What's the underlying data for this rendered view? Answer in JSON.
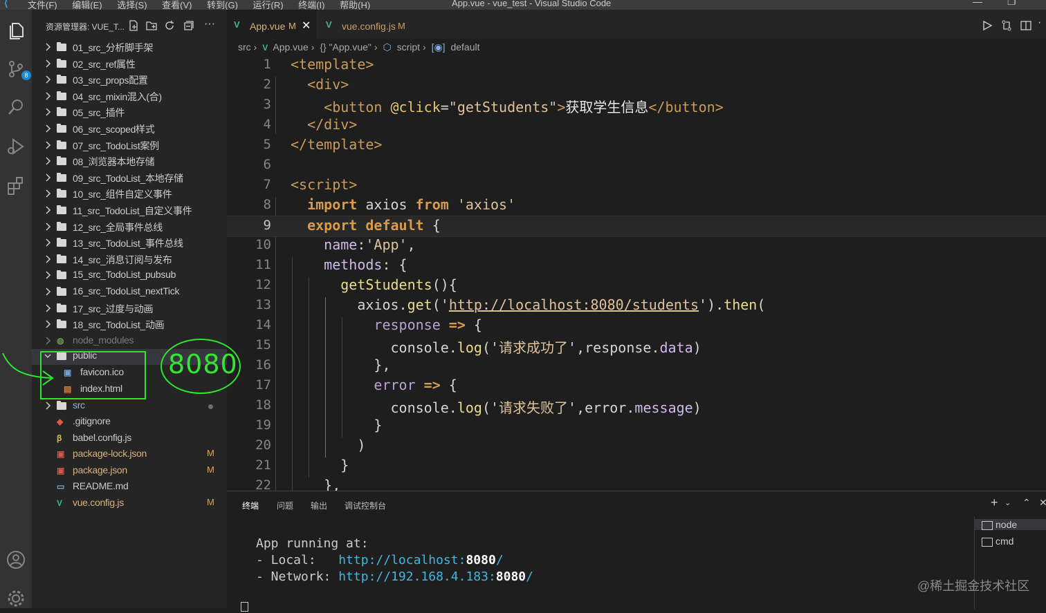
{
  "titlebar": {
    "menu": [
      "文件(F)",
      "编辑(E)",
      "选择(S)",
      "查看(V)",
      "转到(G)",
      "运行(R)",
      "终端(I)",
      "帮助(H)"
    ],
    "title": "App.vue - vue_test - Visual Studio Code"
  },
  "activity": {
    "scm_badge": "8"
  },
  "explorer": {
    "header": "资源管理器: VUE_T...",
    "folders": [
      "01_src_分析脚手架",
      "02_src_ref属性",
      "03_src_props配置",
      "04_src_mixin混入(合)",
      "05_src_插件",
      "06_src_scoped样式",
      "07_src_TodoList案例",
      "08_浏览器本地存储",
      "09_src_TodoList_本地存储",
      "10_src_组件自定义事件",
      "11_src_TodoList_自定义事件",
      "12_src_全局事件总线",
      "13_src_TodoList_事件总线",
      "14_src_消息订阅与发布",
      "15_src_TodoList_pubsub",
      "16_src_TodoList_nextTick",
      "17_src_过度与动画",
      "18_src_TodoList_动画"
    ],
    "node_modules": "node_modules",
    "public": "public",
    "public_children": [
      "favicon.ico",
      "index.html"
    ],
    "src": "src",
    "files": [
      {
        "name": ".gitignore",
        "status": "",
        "color": "#c9c9c9"
      },
      {
        "name": "babel.config.js",
        "status": "",
        "color": "#c9c9c9"
      },
      {
        "name": "package-lock.json",
        "status": "M",
        "color": "#d7b37b"
      },
      {
        "name": "package.json",
        "status": "M",
        "color": "#d7b37b"
      },
      {
        "name": "README.md",
        "status": "",
        "color": "#c9c9c9"
      },
      {
        "name": "vue.config.js",
        "status": "M",
        "color": "#d7b37b"
      }
    ]
  },
  "annotation": {
    "port": "8080"
  },
  "tabs": [
    {
      "name": "App.vue",
      "status": "M",
      "active": true
    },
    {
      "name": "vue.config.js",
      "status": "M",
      "active": false
    }
  ],
  "breadcrumb": [
    "src",
    "App.vue",
    "{} \"App.vue\"",
    "script",
    "default"
  ],
  "code": {
    "current_line": 9,
    "lines": [
      [
        {
          "t": "<template>",
          "c": "tagc"
        }
      ],
      [
        {
          "t": "  <div>",
          "c": "tagc"
        }
      ],
      [
        {
          "t": "    <button ",
          "c": "tagc"
        },
        {
          "t": "@click",
          "c": "attr"
        },
        {
          "t": "=",
          "c": "plain"
        },
        {
          "t": "\"getStudents\"",
          "c": "str"
        },
        {
          "t": ">",
          "c": "tagc"
        },
        {
          "t": "获取学生信息",
          "c": "txt"
        },
        {
          "t": "</button>",
          "c": "tagc"
        }
      ],
      [
        {
          "t": "  </div>",
          "c": "tagc"
        }
      ],
      [
        {
          "t": "</template>",
          "c": "tagc"
        }
      ],
      [],
      [
        {
          "t": "<script>",
          "c": "tagc"
        }
      ],
      [
        {
          "t": "  import ",
          "c": "kw"
        },
        {
          "t": "axios ",
          "c": "plain"
        },
        {
          "t": "from ",
          "c": "kw"
        },
        {
          "t": "'axios'",
          "c": "str"
        }
      ],
      [
        {
          "t": "  export default ",
          "c": "kw"
        },
        {
          "t": "{",
          "c": "plain"
        }
      ],
      [
        {
          "t": "    name",
          "c": "prop"
        },
        {
          "t": ":",
          "c": "plain"
        },
        {
          "t": "'App'",
          "c": "str"
        },
        {
          "t": ",",
          "c": "plain"
        }
      ],
      [
        {
          "t": "    methods",
          "c": "prop"
        },
        {
          "t": ": {",
          "c": "plain"
        }
      ],
      [
        {
          "t": "      getStudents",
          "c": "fn"
        },
        {
          "t": "(){",
          "c": "plain"
        }
      ],
      [
        {
          "t": "        axios",
          "c": "plain"
        },
        {
          "t": ".",
          "c": "plain"
        },
        {
          "t": "get",
          "c": "fn"
        },
        {
          "t": "('",
          "c": "plain"
        },
        {
          "t": "http://localhost:8080/students",
          "c": "str"
        },
        {
          "t": "').",
          "c": "plain"
        },
        {
          "t": "then",
          "c": "fn"
        },
        {
          "t": "(",
          "c": "plain"
        }
      ],
      [
        {
          "t": "          response ",
          "c": "err"
        },
        {
          "t": "=> ",
          "c": "kw"
        },
        {
          "t": "{",
          "c": "plain"
        }
      ],
      [
        {
          "t": "            console",
          "c": "plain"
        },
        {
          "t": ".",
          "c": "plain"
        },
        {
          "t": "log",
          "c": "fn"
        },
        {
          "t": "('",
          "c": "plain"
        },
        {
          "t": "请求成功了",
          "c": "str"
        },
        {
          "t": "',",
          "c": "plain"
        },
        {
          "t": "response",
          "c": "plain"
        },
        {
          "t": ".",
          "c": "plain"
        },
        {
          "t": "data",
          "c": "prop"
        },
        {
          "t": ")",
          "c": "plain"
        }
      ],
      [
        {
          "t": "          },",
          "c": "plain"
        }
      ],
      [
        {
          "t": "          error ",
          "c": "err"
        },
        {
          "t": "=> ",
          "c": "kw"
        },
        {
          "t": "{",
          "c": "plain"
        }
      ],
      [
        {
          "t": "            console",
          "c": "plain"
        },
        {
          "t": ".",
          "c": "plain"
        },
        {
          "t": "log",
          "c": "fn"
        },
        {
          "t": "('",
          "c": "plain"
        },
        {
          "t": "请求失败了",
          "c": "str"
        },
        {
          "t": "',",
          "c": "plain"
        },
        {
          "t": "error",
          "c": "plain"
        },
        {
          "t": ".",
          "c": "plain"
        },
        {
          "t": "message",
          "c": "prop"
        },
        {
          "t": ")",
          "c": "plain"
        }
      ],
      [
        {
          "t": "          }",
          "c": "plain"
        }
      ],
      [
        {
          "t": "        )",
          "c": "plain"
        }
      ],
      [
        {
          "t": "      }",
          "c": "plain"
        }
      ],
      [
        {
          "t": "    },",
          "c": "plain"
        }
      ]
    ]
  },
  "panel": {
    "tabs": [
      "终端",
      "问题",
      "输出",
      "调试控制台"
    ],
    "terminal": {
      "line1": "App running at:",
      "local_label": "- Local:   ",
      "local_url": "http://localhost:",
      "local_port": "8080",
      "local_slash": "/",
      "network_label": "- Network: ",
      "network_url": "http://192.168.4.183:",
      "network_port": "8080",
      "network_slash": "/"
    },
    "terminals": [
      "node",
      "cmd"
    ]
  },
  "watermark": "@稀土掘金技术社区"
}
